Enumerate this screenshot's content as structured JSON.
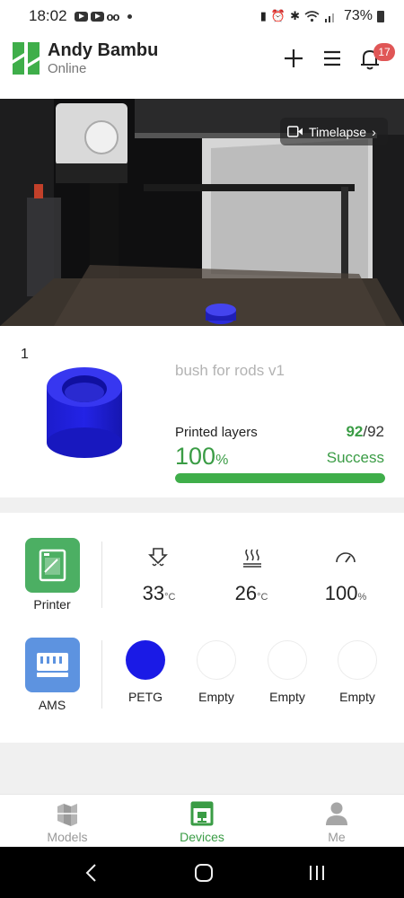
{
  "status_bar": {
    "time": "18:02",
    "battery": "73%"
  },
  "header": {
    "user_name": "Andy Bambu",
    "user_status": "Online",
    "notification_count": "17",
    "icons": [
      "logo-icon",
      "plus-icon",
      "menu-icon",
      "bell-icon"
    ]
  },
  "camera": {
    "timelapse_label": "Timelapse"
  },
  "print_job": {
    "plate_number": "1",
    "name": "bush for rods v1",
    "layers_label": "Printed layers",
    "current_layer": "92",
    "total_layers": "/92",
    "progress_value": "100",
    "progress_unit": "%",
    "progress_fraction": 1.0,
    "status": "Success"
  },
  "devices": {
    "printer_label": "Printer",
    "ams_label": "AMS",
    "stats": [
      {
        "icon": "nozzle-temp-icon",
        "value": "33",
        "unit": "°C"
      },
      {
        "icon": "bed-temp-icon",
        "value": "26",
        "unit": "°C"
      },
      {
        "icon": "speed-icon",
        "value": "100",
        "unit": "%"
      }
    ],
    "ams_slots": [
      {
        "label": "PETG",
        "color": "#1a1ae6"
      },
      {
        "label": "Empty",
        "color": "#ffffff"
      },
      {
        "label": "Empty",
        "color": "#ffffff"
      },
      {
        "label": "Empty",
        "color": "#ffffff"
      }
    ]
  },
  "bottom_nav": {
    "items": [
      {
        "label": "Models",
        "icon": "models-icon"
      },
      {
        "label": "Devices",
        "icon": "devices-icon",
        "active": true
      },
      {
        "label": "Me",
        "icon": "profile-icon"
      }
    ]
  },
  "colors": {
    "accent": "#3a9c45",
    "badge": "#e05656",
    "ams_tile": "#5d93e0",
    "printer_tile": "#4caf63"
  }
}
